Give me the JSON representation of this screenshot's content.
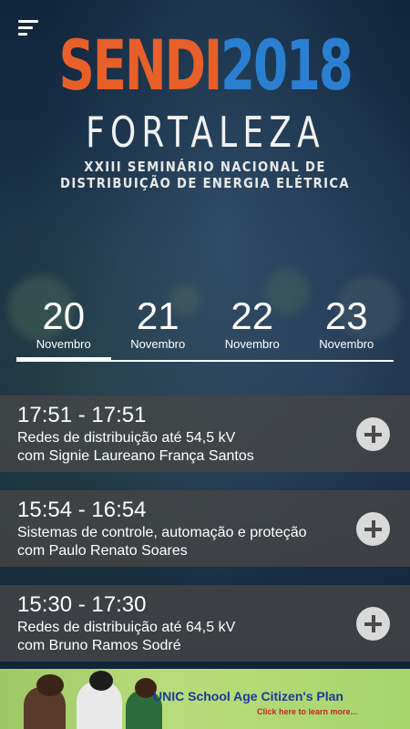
{
  "header": {
    "menu_icon": "hamburger-menu-icon",
    "logo": {
      "sendi": "SENDI",
      "year": "2018",
      "city": "FORTALEZA",
      "subtitle_line1": "XXIII SEMINÁRIO NACIONAL DE",
      "subtitle_line2": "DISTRIBUIÇÃO DE ENERGIA ELÉTRICA"
    }
  },
  "dates": [
    {
      "day": "20",
      "month": "Novembro",
      "active": true
    },
    {
      "day": "21",
      "month": "Novembro",
      "active": false
    },
    {
      "day": "22",
      "month": "Novembro",
      "active": false
    },
    {
      "day": "23",
      "month": "Novembro",
      "active": false
    }
  ],
  "sessions": [
    {
      "time": "17:51 - 17:51",
      "title": "Redes de distribuição até 54,5 kV",
      "speaker": "com Signie Laureano França Santos"
    },
    {
      "time": "15:54 - 16:54",
      "title": "Sistemas de controle, automação e proteção",
      "speaker": "com Paulo Renato Soares"
    },
    {
      "time": "15:30 - 17:30",
      "title": "Redes de distribuição até 64,5 kV",
      "speaker": "com Bruno Ramos Sodré"
    }
  ],
  "ad": {
    "title": "UNIC School Age Citizen's Plan",
    "subtitle": "Click here to learn more..."
  },
  "colors": {
    "sendi": "#e85f2a",
    "year": "#2a7fd1",
    "session_bg": "#464646",
    "add_button": "#d9d9d9"
  }
}
